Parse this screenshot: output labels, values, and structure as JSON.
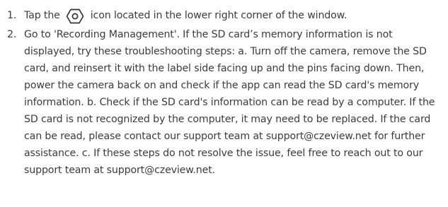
{
  "steps": [
    {
      "number": "1.",
      "before_icon": "Tap the",
      "icon": "settings-hexagon-icon",
      "after_icon": "icon located in the lower right corner of the window."
    },
    {
      "number": "2.",
      "text": "Go to 'Recording Management'. If the SD card’s memory information is not displayed, try these troubleshooting steps: a. Turn off the camera, remove the SD card, and reinsert it with the label side facing up and the pins facing down. Then, power the camera back on and check if the app can read the SD card's memory information. b. Check if the SD card's information can be read by a computer. If the SD card is not recognized by the computer, it may need to be replaced. If the card can be read, please contact our support team at support@czeview.net for further assistance. c. If these steps do not resolve the issue, feel free to reach out to our support team at support@czeview.net."
    }
  ],
  "colors": {
    "text": "#3c3c3c",
    "icon": "#333333",
    "background": "#ffffff"
  }
}
